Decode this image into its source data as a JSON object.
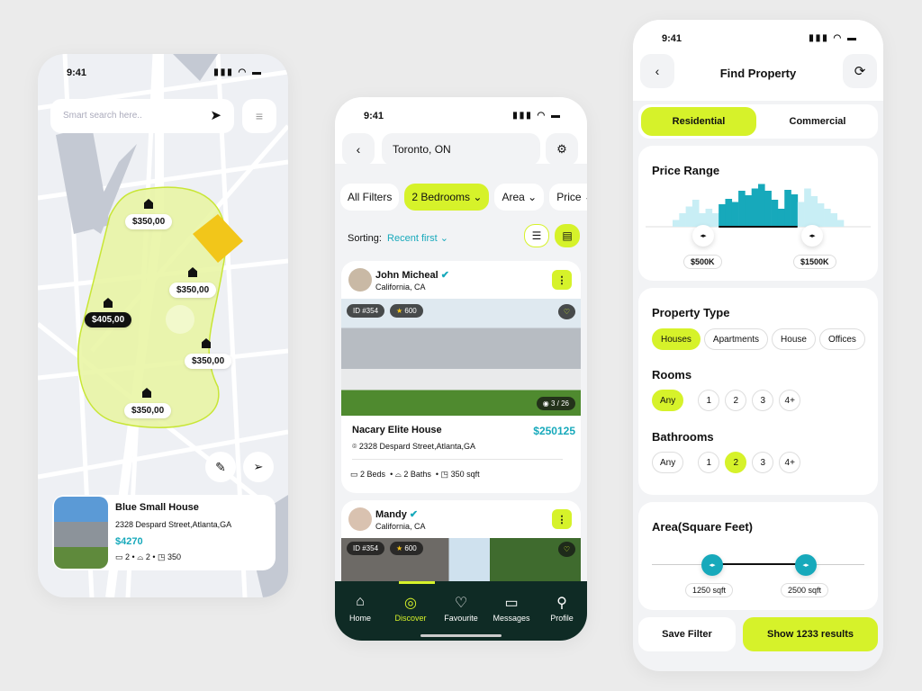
{
  "colors": {
    "accent": "#d6f22a",
    "teal": "#17a9bb",
    "nav_bg": "#0f2b25",
    "zone": "#e8f5a0"
  },
  "status": {
    "time": "9:41"
  },
  "map_screen": {
    "search_placeholder": "Smart search here..",
    "price_pins": [
      "$350,00",
      "$350,00",
      "$405,00",
      "$350,00",
      "$350,00"
    ],
    "selected_pin": "$405,00",
    "listing": {
      "title": "Blue Small House",
      "address": "2328 Despard Street,Atlanta,GA",
      "price": "$4270",
      "beds": "2",
      "baths": "2",
      "area": "350"
    }
  },
  "discover_screen": {
    "location": "Toronto, ON",
    "filters": [
      "All Filters",
      "2 Bedrooms",
      "Area",
      "Price"
    ],
    "sorting_label": "Sorting:",
    "sorting_value": "Recent first",
    "listings": [
      {
        "agent": "John Micheal",
        "agent_location": "California, CA",
        "id": "ID #354",
        "rating": "600",
        "photos": "3 / 26",
        "title": "Nacary Elite House",
        "price": "$250125",
        "address": "2328 Despard Street,Atlanta,GA",
        "beds": "2 Beds",
        "baths": "2 Baths",
        "area": "350 sqft"
      },
      {
        "agent": "Mandy",
        "agent_location": "California, CA",
        "id": "ID #354",
        "rating": "600"
      }
    ],
    "nav": [
      {
        "label": "Home",
        "icon": "home-icon"
      },
      {
        "label": "Discover",
        "icon": "compass-icon",
        "active": true
      },
      {
        "label": "Favourite",
        "icon": "heart-icon"
      },
      {
        "label": "Messages",
        "icon": "message-icon"
      },
      {
        "label": "Profile",
        "icon": "user-icon"
      }
    ]
  },
  "filter_screen": {
    "title": "Find Property",
    "tabs": [
      {
        "label": "Residential",
        "active": true
      },
      {
        "label": "Commercial"
      }
    ],
    "price_range": {
      "title": "Price Range",
      "min": "$500K",
      "max": "$1500K",
      "histogram": [
        0.15,
        0.3,
        0.45,
        0.6,
        0.3,
        0.4,
        0.3,
        0.5,
        0.62,
        0.55,
        0.8,
        0.7,
        0.85,
        0.95,
        0.8,
        0.6,
        0.4,
        0.82,
        0.72,
        0.55,
        0.85,
        0.68,
        0.52,
        0.4,
        0.3,
        0.15
      ],
      "selected_from": 0.27,
      "selected_to": 0.73
    },
    "property_type": {
      "title": "Property Type",
      "options": [
        "Houses",
        "Apartments",
        "House",
        "Offices"
      ],
      "selected": "Houses"
    },
    "rooms": {
      "title": "Rooms",
      "options": [
        "Any",
        "1",
        "2",
        "3",
        "4+"
      ],
      "selected": "Any"
    },
    "bathrooms": {
      "title": "Bathrooms",
      "options": [
        "Any",
        "1",
        "2",
        "3",
        "4+"
      ],
      "selected": "2"
    },
    "area": {
      "title": "Area(Square Feet)",
      "min": "1250 sqft",
      "max": "2500 sqft"
    },
    "save_label": "Save Filter",
    "show_label": "Show 1233 results"
  }
}
